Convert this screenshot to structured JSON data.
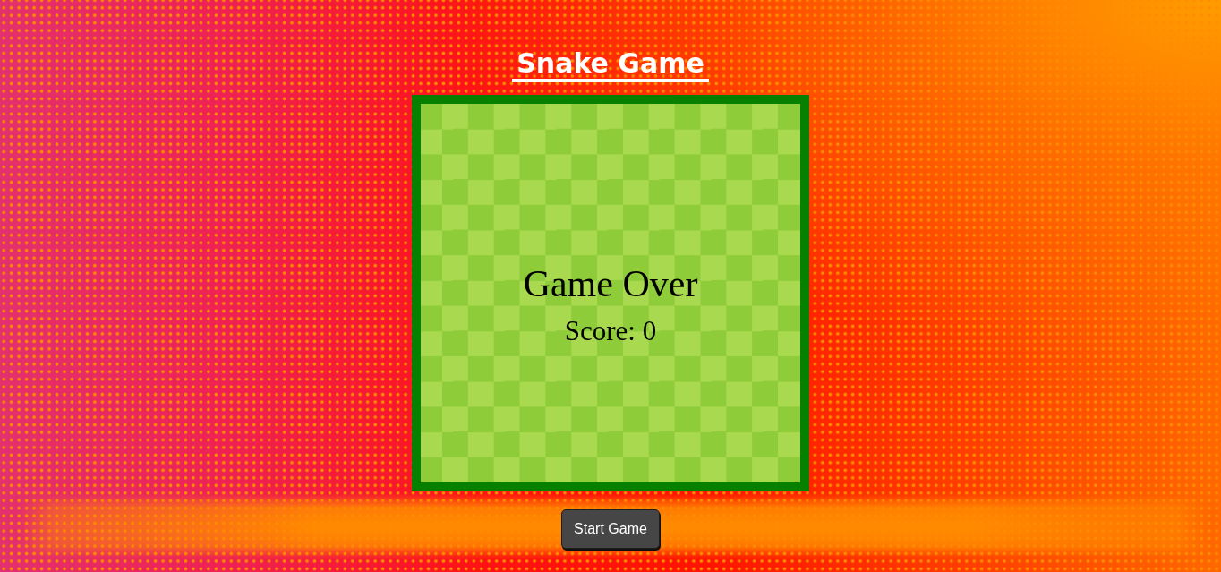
{
  "title": "Snake Game",
  "board": {
    "message": "Game Over",
    "score": "Score: 0"
  },
  "start_button": {
    "label": "Start Game"
  }
}
